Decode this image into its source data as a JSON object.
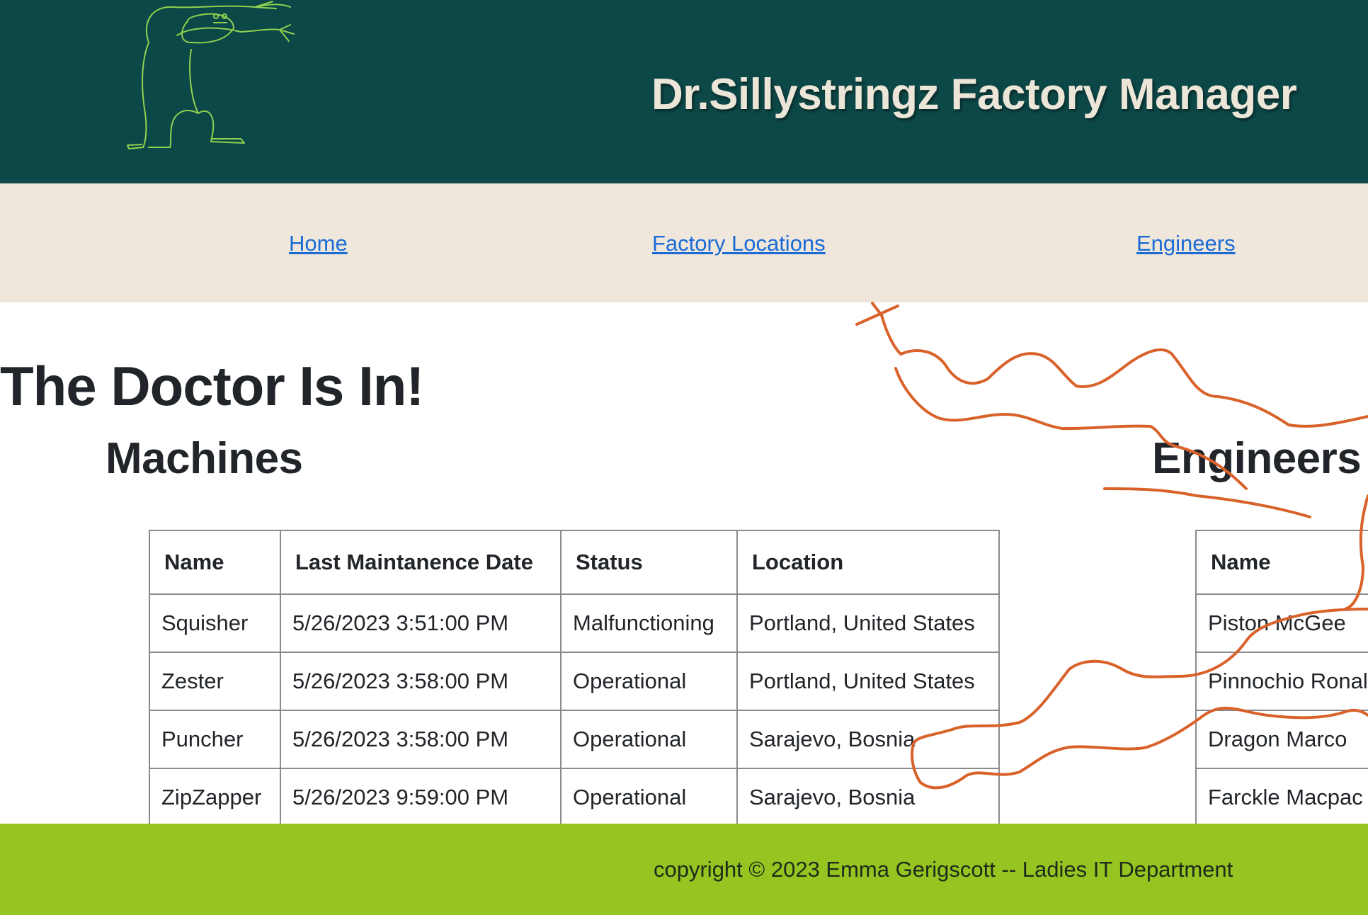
{
  "header": {
    "title": "Dr.Sillystringz Factory Manager",
    "logo_icon": "doodle-creature-logo-icon",
    "logo_color": "#8fd14f",
    "background": "#0d4848"
  },
  "nav": {
    "items": [
      {
        "label": "Home"
      },
      {
        "label": "Factory Locations"
      },
      {
        "label": "Engineers"
      }
    ],
    "background": "#efe7dc",
    "link_color": "#1a6bd6"
  },
  "main": {
    "heading": "The Doctor Is In!",
    "machines": {
      "title": "Machines",
      "columns": [
        "Name",
        "Last Maintanence Date",
        "Status",
        "Location"
      ],
      "rows": [
        [
          "Squisher",
          "5/26/2023 3:51:00 PM",
          "Malfunctioning",
          "Portland, United States"
        ],
        [
          "Zester",
          "5/26/2023 3:58:00 PM",
          "Operational",
          "Portland, United States"
        ],
        [
          "Puncher",
          "5/26/2023 3:58:00 PM",
          "Operational",
          "Sarajevo, Bosnia"
        ],
        [
          "ZipZapper",
          "5/26/2023 9:59:00 PM",
          "Operational",
          "Sarajevo, Bosnia"
        ]
      ]
    },
    "engineers": {
      "title": "Engineers",
      "columns": [
        "Name"
      ],
      "rows": [
        [
          "Piston McGee"
        ],
        [
          "Pinnochio Ronal"
        ],
        [
          "Dragon Marco"
        ],
        [
          "Farckle Macpac"
        ]
      ]
    },
    "decoration": {
      "icon": "silly-string-squiggle-icon",
      "color": "#d9622b"
    }
  },
  "footer": {
    "text": "copyright © 2023 Emma Gerigscott -- Ladies IT Department",
    "background": "#96c421"
  }
}
